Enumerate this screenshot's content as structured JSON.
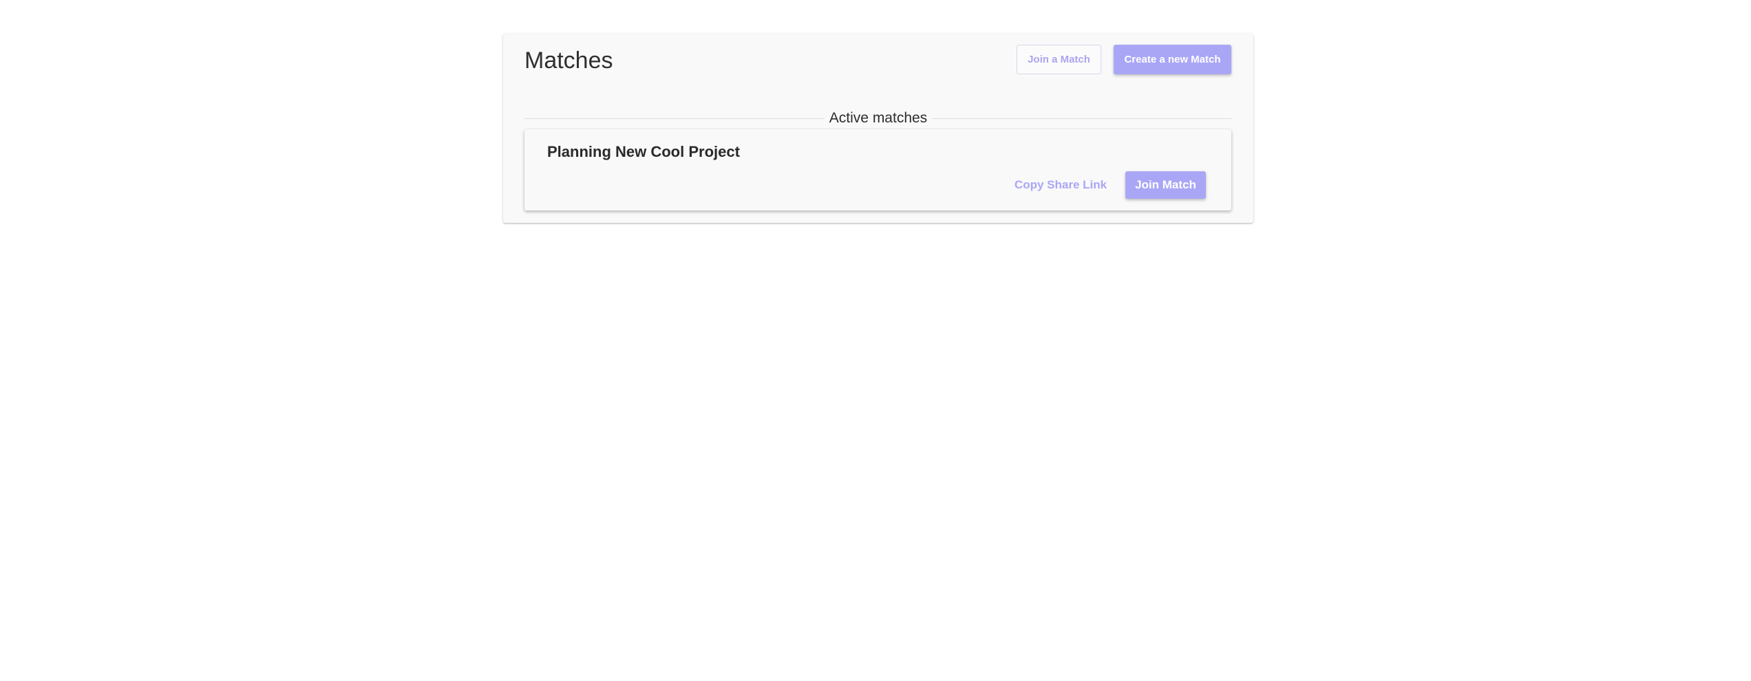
{
  "header": {
    "title": "Matches",
    "join_button_label": "Join a Match",
    "create_button_label": "Create a new Match"
  },
  "sections": {
    "active_matches_label": "Active matches"
  },
  "matches": [
    {
      "title": "Planning New Cool Project",
      "copy_link_label": "Copy Share Link",
      "join_label": "Join Match"
    }
  ],
  "colors": {
    "accent": "#aaa6f6",
    "panel_background": "#f9f9f9",
    "text": "#2c2c2c"
  }
}
